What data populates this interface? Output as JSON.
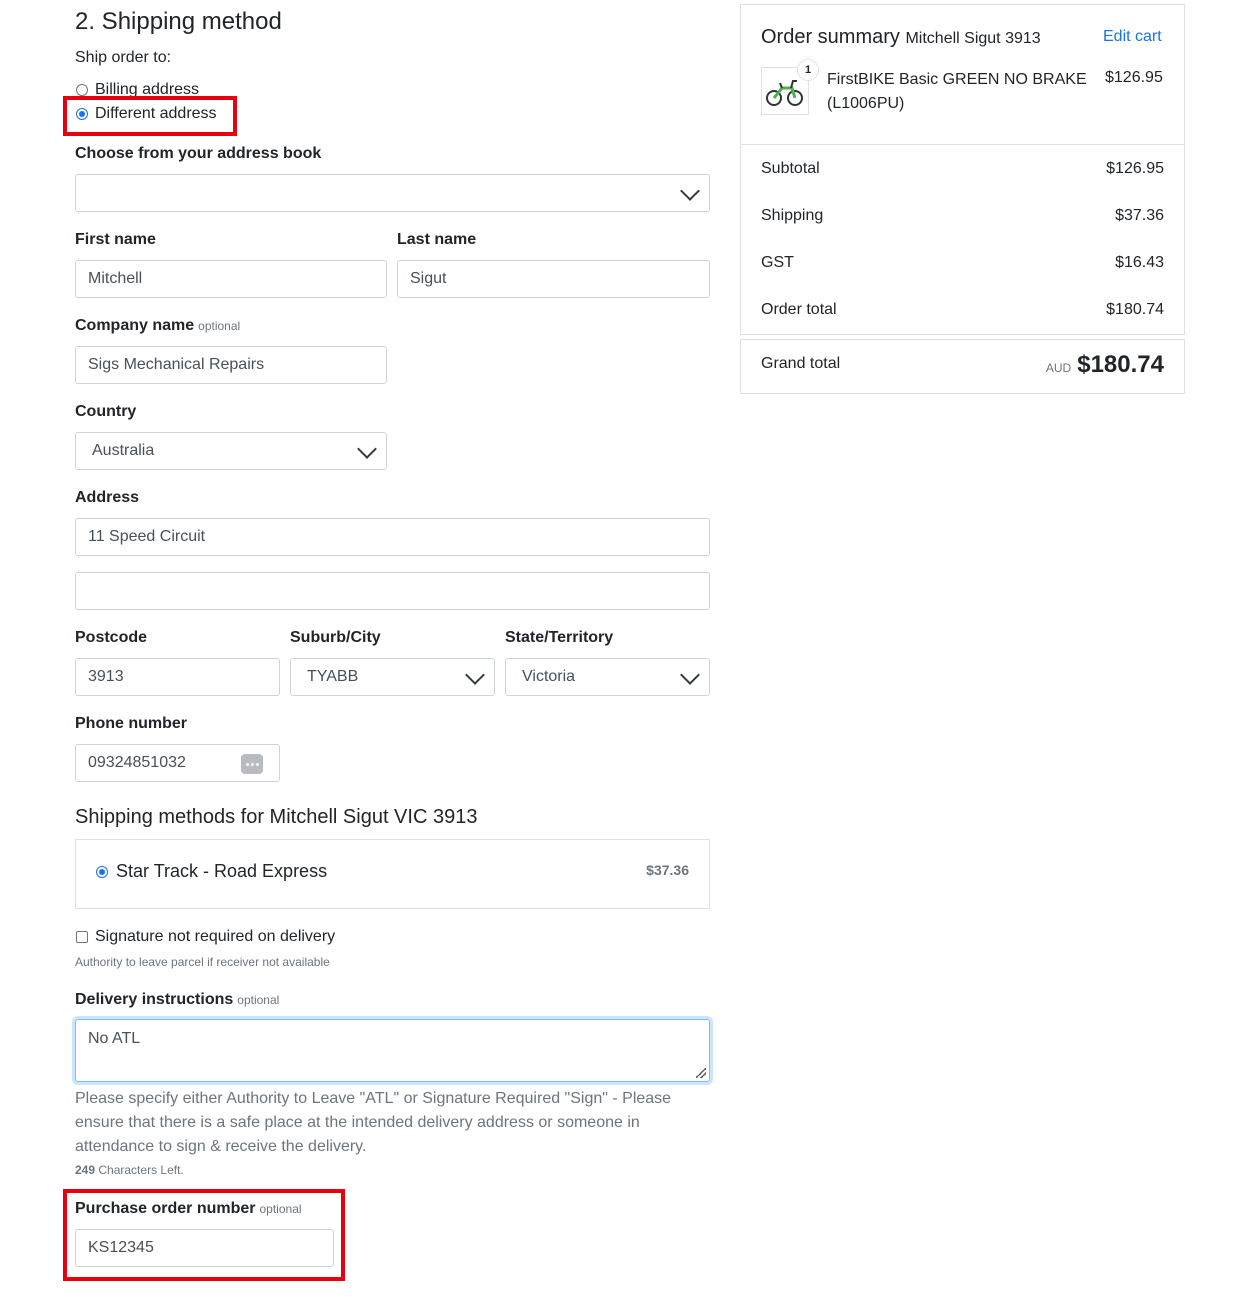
{
  "section_title": "2. Shipping method",
  "ship_to": {
    "label": "Ship order to:",
    "billing": "Billing address",
    "different": "Different address"
  },
  "address_book": {
    "label": "Choose from your address book",
    "value": ""
  },
  "form": {
    "first_name_label": "First name",
    "first_name": "Mitchell",
    "last_name_label": "Last name",
    "last_name": "Sigut",
    "company_label": "Company name",
    "optional": "optional",
    "company": "Sigs Mechanical Repairs",
    "country_label": "Country",
    "country": "Australia",
    "address_label": "Address",
    "address1": "11 Speed Circuit",
    "address2": "",
    "postcode_label": "Postcode",
    "postcode": "3913",
    "suburb_label": "Suburb/City",
    "suburb": "TYABB",
    "state_label": "State/Territory",
    "state": "Victoria",
    "phone_label": "Phone number",
    "phone": "09324851032"
  },
  "shipping": {
    "title": "Shipping methods for Mitchell Sigut VIC 3913",
    "method": "Star Track - Road Express",
    "price": "$37.36"
  },
  "signature": {
    "label": "Signature not required on delivery",
    "help": "Authority to leave parcel if receiver not available"
  },
  "delivery": {
    "label": "Delivery instructions",
    "optional": "optional",
    "value": "No ATL",
    "help": "Please specify either Authority to Leave \"ATL\" or Signature Required \"Sign\" - Please ensure that there is a safe place at the intended delivery address or someone in attendance to sign & receive the delivery.",
    "chars_count": "249",
    "chars_text": "Characters Left."
  },
  "po": {
    "label": "Purchase order number",
    "optional": "optional",
    "value": "KS12345"
  },
  "summary": {
    "title": "Order summary",
    "customer": "Mitchell Sigut 3913",
    "edit_cart": "Edit cart",
    "item_qty": "1",
    "item_name": "FirstBIKE Basic GREEN NO BRAKE (L1006PU)",
    "item_price": "$126.95",
    "subtotal_label": "Subtotal",
    "subtotal": "$126.95",
    "shipping_label": "Shipping",
    "shipping": "$37.36",
    "gst_label": "GST",
    "gst": "$16.43",
    "order_total_label": "Order total",
    "order_total": "$180.74",
    "grand_total_label": "Grand total",
    "currency": "AUD",
    "grand_total": "$180.74"
  },
  "colors": {
    "accent": "#1a73e8",
    "highlight": "#e8000f",
    "border": "#ced4da"
  }
}
